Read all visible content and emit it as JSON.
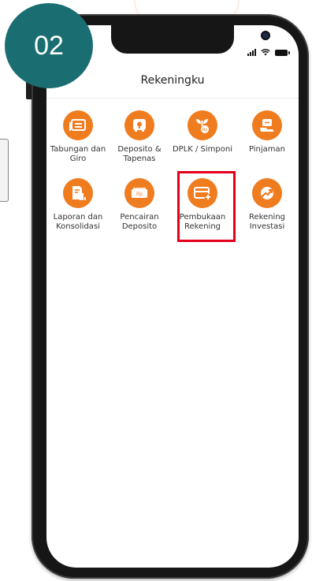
{
  "step_badge": "02",
  "app": {
    "title": "Rekeningku"
  },
  "colors": {
    "accent": "#f07c20",
    "badge": "#1a6e72",
    "highlight": "#e4001b"
  },
  "menu": [
    {
      "label": "Tabungan dan Giro",
      "icon": "passbook-icon"
    },
    {
      "label": "Deposito & Tapenas",
      "icon": "safe-box-icon"
    },
    {
      "label": "DPLK / Simponi",
      "icon": "money-plant-icon"
    },
    {
      "label": "Pinjaman",
      "icon": "hand-loan-icon"
    },
    {
      "label": "Laporan dan Konsolidasi",
      "icon": "report-icon"
    },
    {
      "label": "Pencairan Deposito",
      "icon": "cash-note-icon"
    },
    {
      "label": "Pembukaan Rekening",
      "icon": "add-card-icon"
    },
    {
      "label": "Rekening Investasi",
      "icon": "trend-up-icon"
    }
  ]
}
